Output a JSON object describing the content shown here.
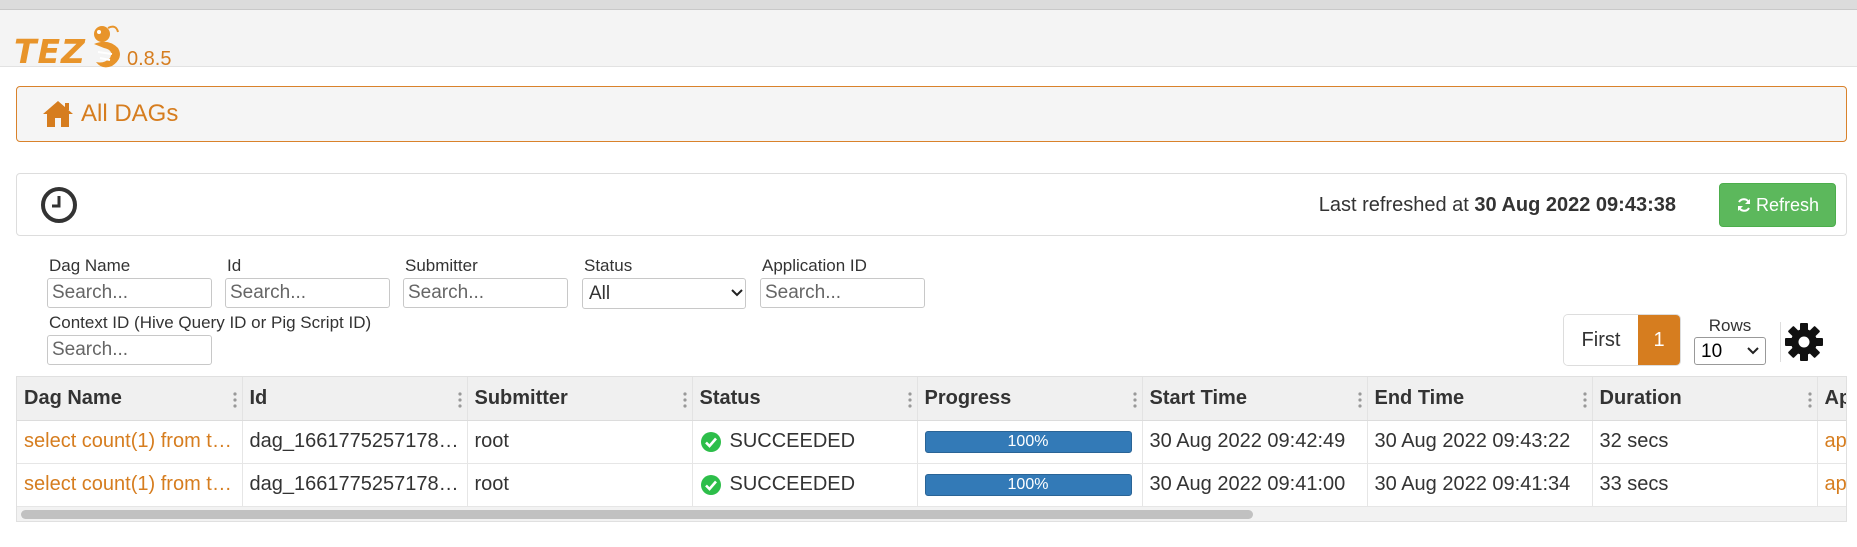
{
  "app": {
    "logo_text": "TEZ",
    "version": "0.8.5"
  },
  "breadcrumb": {
    "label": "All DAGs"
  },
  "refresh": {
    "prefix": "Last refreshed at ",
    "timestamp": "30 Aug 2022 09:43:38",
    "button_label": "Refresh"
  },
  "filters": {
    "dag_name": {
      "label": "Dag Name",
      "placeholder": "Search..."
    },
    "id": {
      "label": "Id",
      "placeholder": "Search..."
    },
    "submitter": {
      "label": "Submitter",
      "placeholder": "Search..."
    },
    "status": {
      "label": "Status",
      "selected": "All"
    },
    "application_id": {
      "label": "Application ID",
      "placeholder": "Search..."
    },
    "context_id": {
      "label": "Context ID (Hive Query ID or Pig Script ID)",
      "placeholder": "Search..."
    }
  },
  "pagination": {
    "first_label": "First",
    "current_page": "1",
    "rows_label": "Rows",
    "rows_selected": "10"
  },
  "table": {
    "columns": [
      "Dag Name",
      "Id",
      "Submitter",
      "Status",
      "Progress",
      "Start Time",
      "End Time",
      "Duration",
      "Ap"
    ],
    "rows": [
      {
        "dag_name": "select count(1) from t…",
        "id": "dag_1661775257178…",
        "submitter": "root",
        "status": "SUCCEEDED",
        "progress": "100%",
        "start_time": "30 Aug 2022 09:42:49",
        "end_time": "30 Aug 2022 09:43:22",
        "duration": "32 secs",
        "application": "ap"
      },
      {
        "dag_name": "select count(1) from t…",
        "id": "dag_1661775257178…",
        "submitter": "root",
        "status": "SUCCEEDED",
        "progress": "100%",
        "start_time": "30 Aug 2022 09:41:00",
        "end_time": "30 Aug 2022 09:41:34",
        "duration": "33 secs",
        "application": "ap"
      }
    ]
  },
  "colors": {
    "brand_orange": "#d67d1f",
    "refresh_green": "#5cb85c",
    "progress_blue": "#337ab7",
    "success_green": "#2dbe4a"
  }
}
